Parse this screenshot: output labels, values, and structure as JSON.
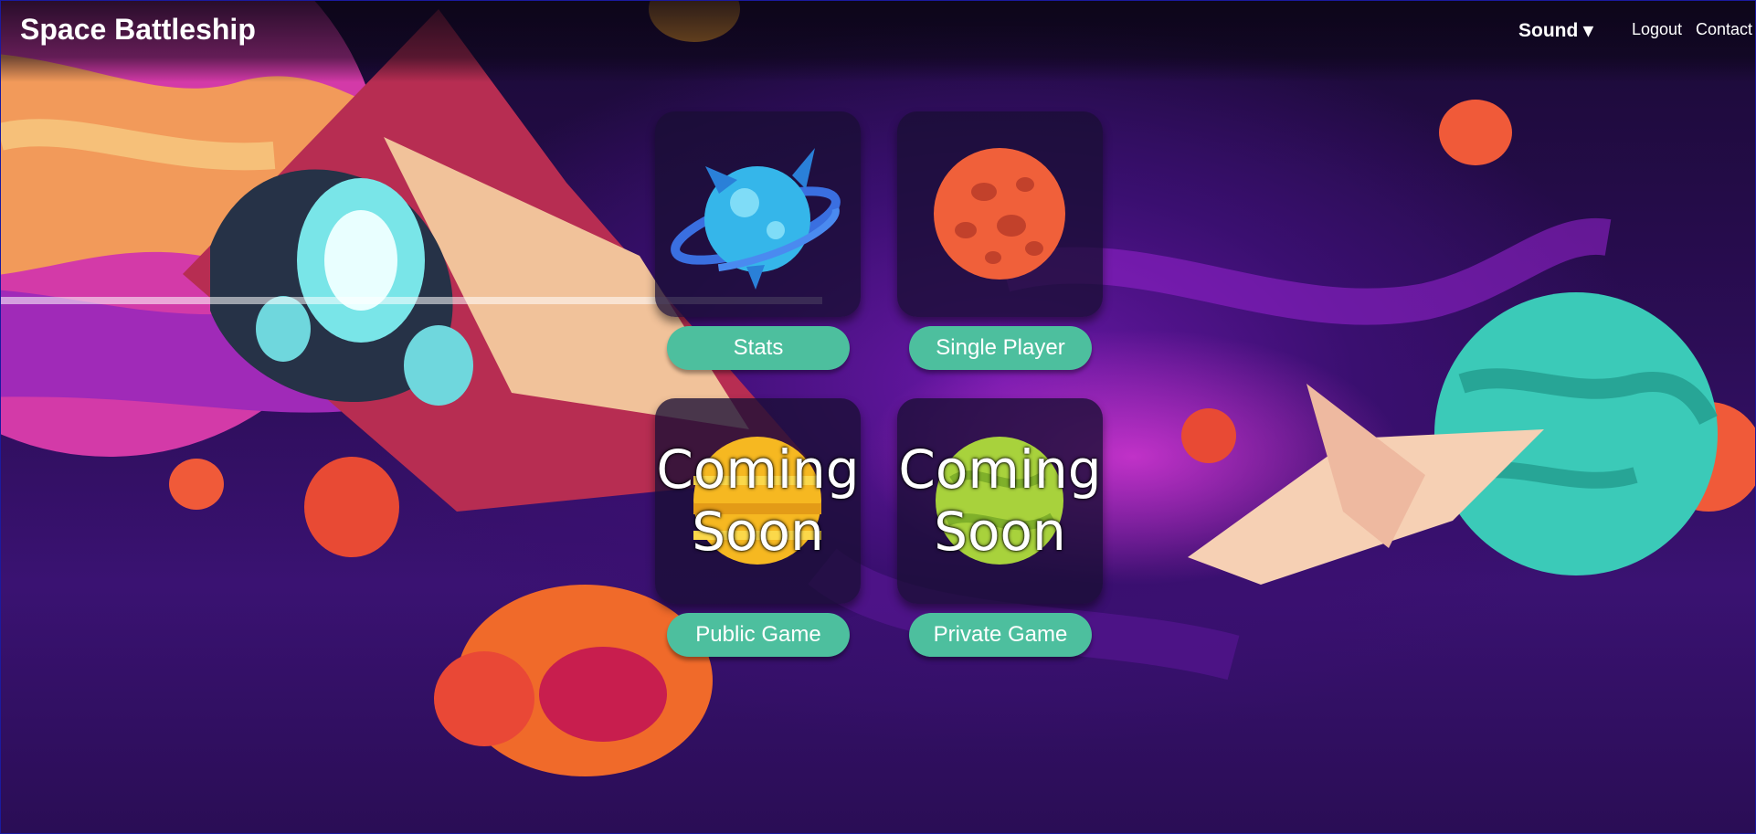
{
  "header": {
    "title": "Space Battleship",
    "nav": {
      "sound": "Sound ▾",
      "logout": "Logout",
      "contact": "Contact"
    }
  },
  "menu": {
    "stats": {
      "label": "Stats",
      "icon": "blue-spiked-planet-icon"
    },
    "single_player": {
      "label": "Single Player",
      "icon": "red-cratered-planet-icon"
    },
    "public_game": {
      "label": "Public Game",
      "icon": "yellow-striped-planet-icon",
      "overlay": "Coming Soon"
    },
    "private_game": {
      "label": "Private Game",
      "icon": "green-planet-icon",
      "overlay": "Coming Soon"
    }
  },
  "colors": {
    "button": "#4dbf9e",
    "card": "#1a0e34",
    "background": "#2b0d55"
  }
}
